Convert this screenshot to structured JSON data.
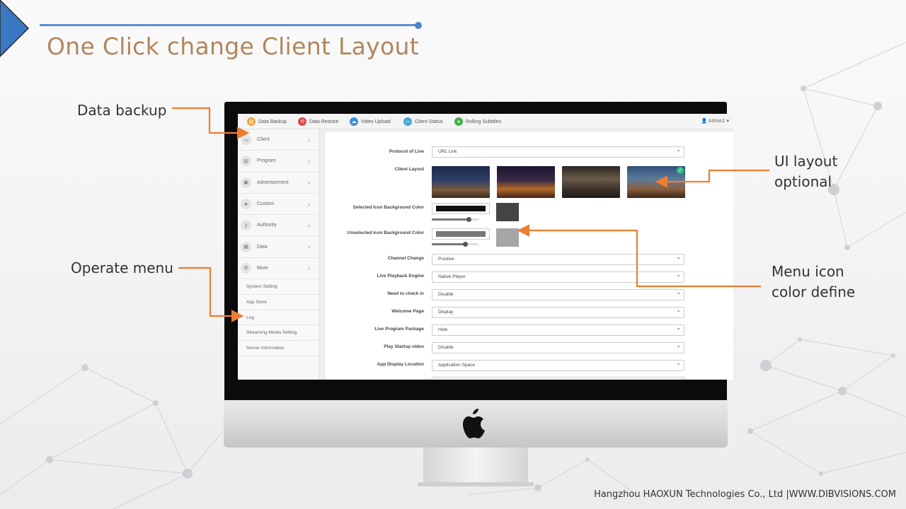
{
  "slide": {
    "title": "One Click change Client Layout",
    "footer": "Hangzhou HAOXUN Technologies Co., Ltd |WWW.DIBVISIONS.COM"
  },
  "callouts": {
    "data_backup": "Data backup",
    "operate_menu": "Operate menu",
    "ui_layout": [
      "UI layout",
      "optional"
    ],
    "menu_icon_color": [
      "Menu icon",
      "color define"
    ]
  },
  "colors": {
    "accent_orange": "#ed7d31",
    "title_color": "#b0875d",
    "title_line": "#5b8fd2"
  },
  "app": {
    "toolbar": [
      {
        "label": "Data Backup",
        "icon": "database-icon",
        "color": "#f0a53a"
      },
      {
        "label": "Data Restore",
        "icon": "restore-icon",
        "color": "#e04848"
      },
      {
        "label": "Video Upload",
        "icon": "cloud-upload-icon",
        "color": "#3d8fd8"
      },
      {
        "label": "Client Status",
        "icon": "monitor-icon",
        "color": "#3aa8d8"
      },
      {
        "label": "Rolling Subtitles",
        "icon": "chat-icon",
        "color": "#44b04a"
      }
    ],
    "user": "Admin1",
    "sidebar": {
      "main": [
        {
          "label": "Client",
          "icon": "monitor-icon"
        },
        {
          "label": "Program",
          "icon": "film-icon"
        },
        {
          "label": "Advertisement",
          "icon": "image-icon"
        },
        {
          "label": "Custom",
          "icon": "star-icon"
        },
        {
          "label": "Authority",
          "icon": "key-icon"
        },
        {
          "label": "Data",
          "icon": "chart-icon"
        },
        {
          "label": "More",
          "icon": "gear-icon"
        }
      ],
      "sub": [
        "System Setting",
        "App Store",
        "Log",
        "Streaming Media Setting",
        "Server Information"
      ]
    },
    "form": {
      "protocol_label": "Protocol of Live",
      "protocol_value": "URL Link",
      "client_layout_label": "Client Layout",
      "selected_label": "Selected Icon Background Color",
      "selected_color": "#111111",
      "selected_swatch": "#444444",
      "selected_level": 0.8,
      "unselected_label": "Unselected Icon Background Color",
      "unselected_color": "#777777",
      "unselected_swatch": "#a6a6a6",
      "unselected_level": 0.72,
      "selects": [
        {
          "label": "Channel Change",
          "value": "Positive"
        },
        {
          "label": "Live Playback Engine",
          "value": "Native Player"
        },
        {
          "label": "Need to check in",
          "value": "Disable"
        },
        {
          "label": "Welcome Page",
          "value": "Display"
        },
        {
          "label": "Live Program Package",
          "value": "Hide"
        },
        {
          "label": "Play Startup video",
          "value": "Disable"
        },
        {
          "label": "App Display Location",
          "value": "Application Space"
        }
      ]
    }
  }
}
